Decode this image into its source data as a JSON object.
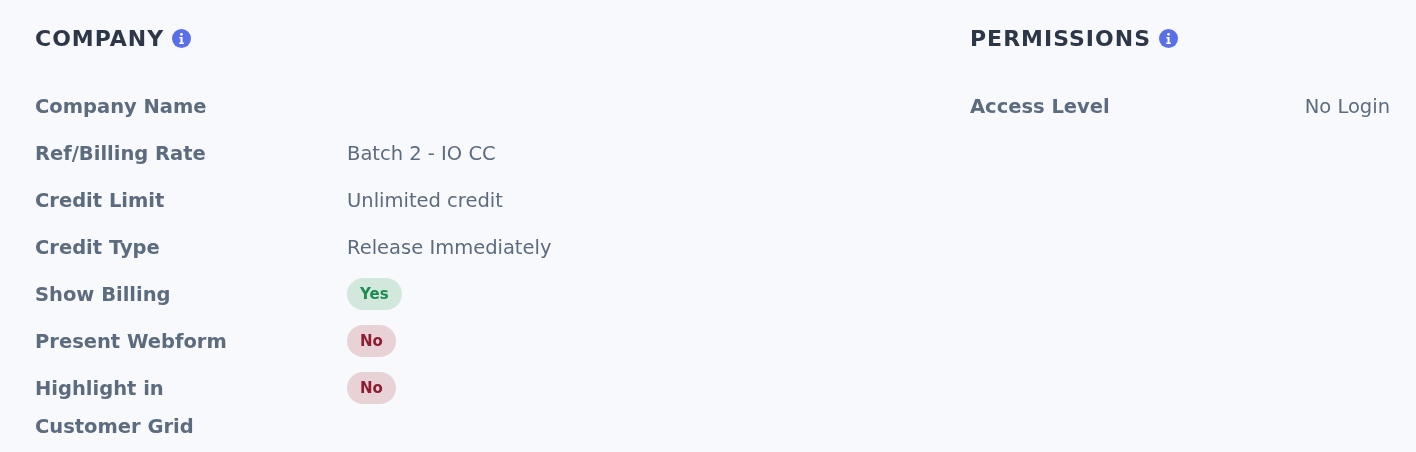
{
  "sections": [
    {
      "title": "COMPANY",
      "rows": [
        {
          "label": "Company Name",
          "kind": "text"
        },
        {
          "label": "Ref/Billing Rate",
          "kind": "text",
          "value": "Batch 2 - IO CC"
        },
        {
          "label": "Credit Limit",
          "kind": "text",
          "value": "Unlimited credit"
        },
        {
          "label": "Credit Type",
          "kind": "text",
          "value": "Release Immediately"
        },
        {
          "label": "Show Billing",
          "kind": "badge",
          "value": "Yes",
          "color": "#1f8a52"
        },
        {
          "label": "Present Webform",
          "kind": "badge",
          "value": "No",
          "color": "#8e1c33"
        },
        {
          "label": "Highlight in Customer Grid",
          "kind": "badge",
          "value": "No",
          "color": "#8e1c33"
        }
      ]
    },
    {
      "title": "PERMISSIONS",
      "rows": [
        {
          "label": "Access Level",
          "kind": "text",
          "value": "No Login"
        }
      ]
    }
  ]
}
